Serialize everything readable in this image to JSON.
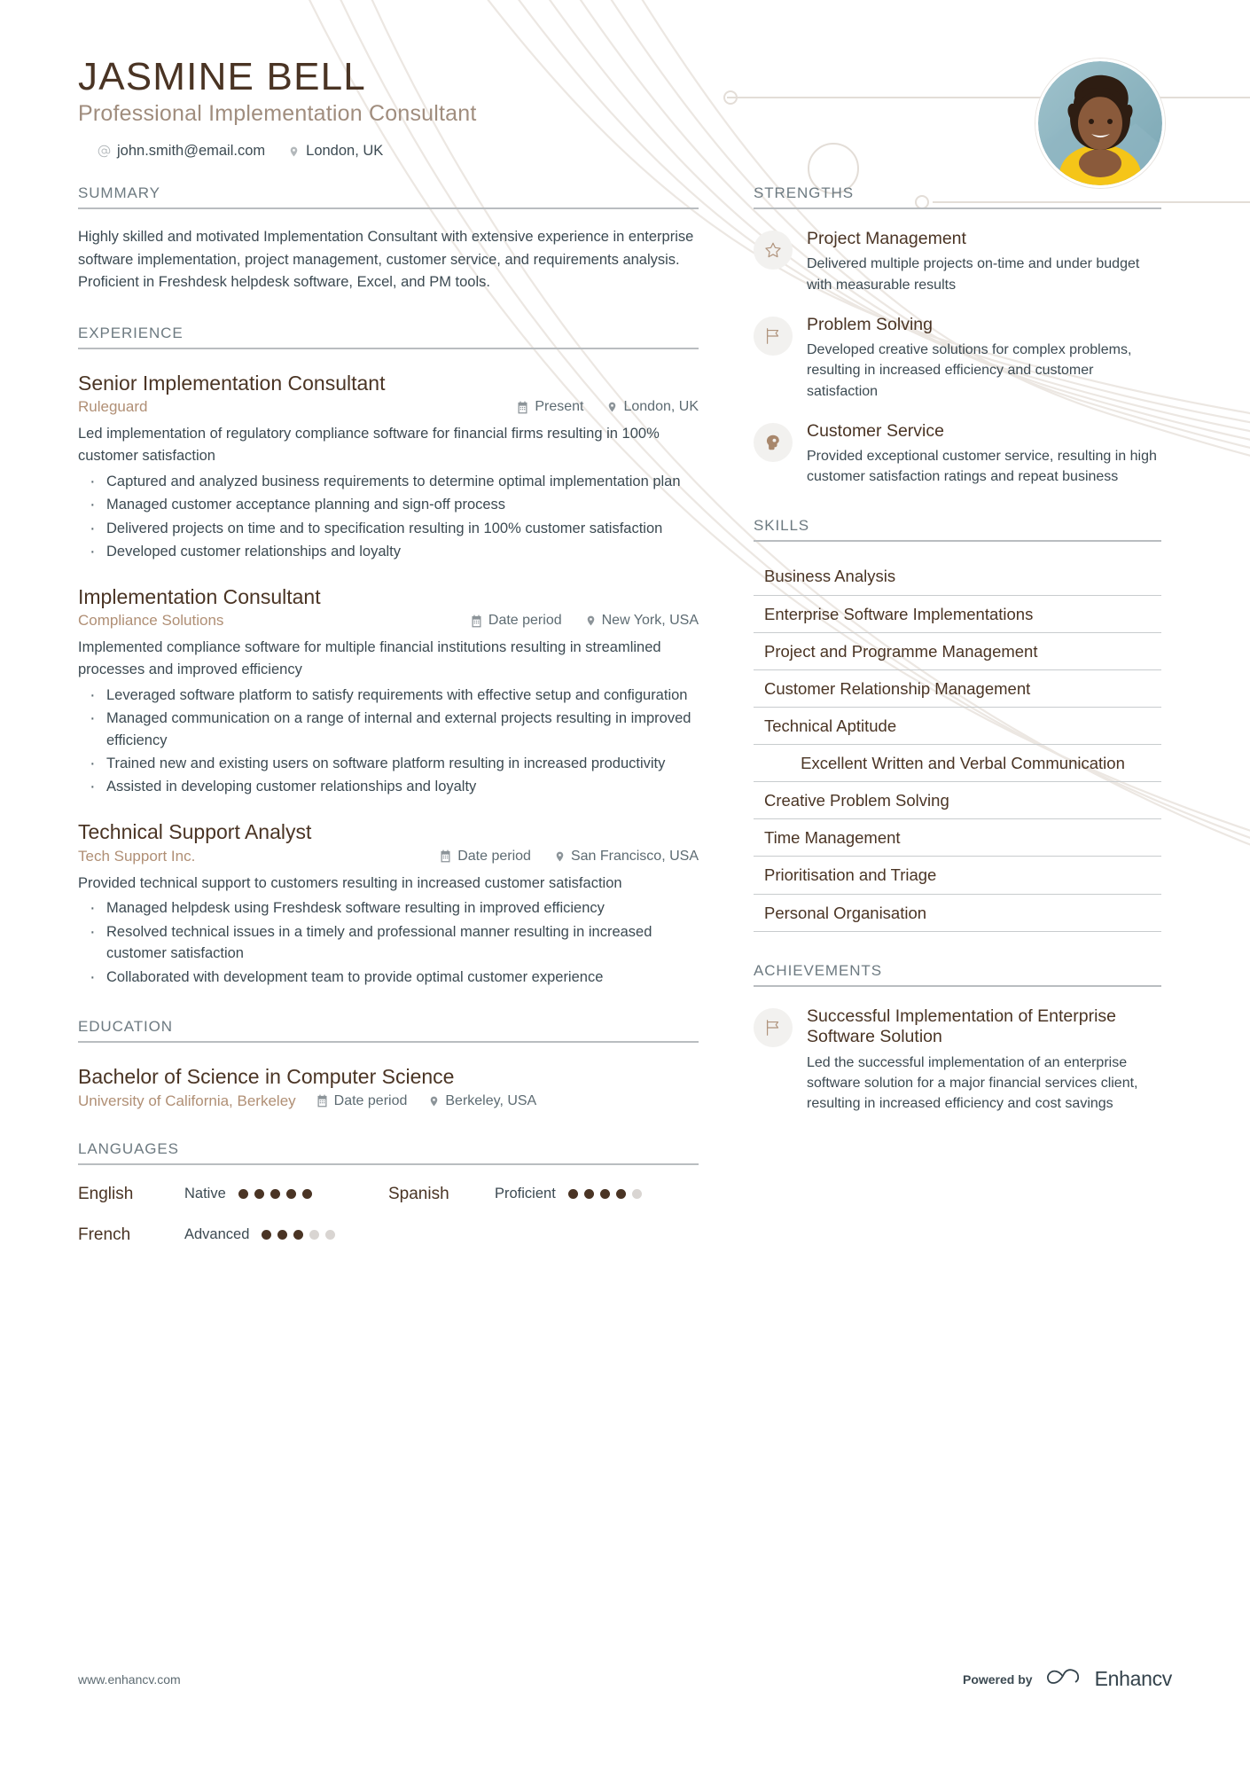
{
  "header": {
    "name": "JASMINE BELL",
    "job_title": "Professional Implementation Consultant",
    "email": "john.smith@email.com",
    "location": "London, UK",
    "email_icon": "at-sign-icon",
    "location_icon": "map-pin-icon",
    "avatar_alt": "profile-photo"
  },
  "colors": {
    "heading_brown": "#4a3424",
    "accent_tan": "#b08f75",
    "body_slate": "#3c4a52",
    "rule_gray": "#b9bdc0",
    "icon_bg": "#f2f1ef"
  },
  "summary": {
    "title": "SUMMARY",
    "text": "Highly skilled and motivated Implementation Consultant with extensive experience in enterprise software implementation, project management, customer service, and requirements analysis. Proficient in Freshdesk helpdesk software, Excel, and PM tools."
  },
  "experience": {
    "title": "EXPERIENCE",
    "jobs": [
      {
        "role": "Senior Implementation Consultant",
        "company": "Ruleguard",
        "date": "Present",
        "location": "London, UK",
        "description": "Led implementation of regulatory compliance software for financial firms resulting in 100% customer satisfaction",
        "bullets": [
          "Captured and analyzed business requirements to determine optimal implementation plan",
          "Managed customer acceptance planning and sign-off process",
          "Delivered projects on time and to specification resulting in 100% customer satisfaction",
          "Developed customer relationships and loyalty"
        ]
      },
      {
        "role": "Implementation Consultant",
        "company": "Compliance Solutions",
        "date": "Date period",
        "location": "New York, USA",
        "description": "Implemented compliance software for multiple financial institutions resulting in streamlined processes and improved efficiency",
        "bullets": [
          "Leveraged software platform to satisfy requirements with effective setup and configuration",
          "Managed communication on a range of internal and external projects resulting in improved efficiency",
          "Trained new and existing users on software platform resulting in increased productivity",
          "Assisted in developing customer relationships and loyalty"
        ]
      },
      {
        "role": "Technical Support Analyst",
        "company": "Tech Support Inc.",
        "date": "Date period",
        "location": "San Francisco, USA",
        "description": "Provided technical support to customers resulting in increased customer satisfaction",
        "bullets": [
          "Managed helpdesk using Freshdesk software resulting in improved efficiency",
          "Resolved technical issues in a timely and professional manner resulting in increased customer satisfaction",
          "Collaborated with development team to provide optimal customer experience"
        ]
      }
    ]
  },
  "education": {
    "title": "EDUCATION",
    "entries": [
      {
        "degree": "Bachelor of Science in Computer Science",
        "school": "University of California, Berkeley",
        "date": "Date period",
        "location": "Berkeley, USA"
      }
    ]
  },
  "languages": {
    "title": "LANGUAGES",
    "items": [
      {
        "name": "English",
        "level": "Native",
        "rating": 5,
        "max": 5
      },
      {
        "name": "Spanish",
        "level": "Proficient",
        "rating": 4,
        "max": 5
      },
      {
        "name": "French",
        "level": "Advanced",
        "rating": 3,
        "max": 5
      }
    ]
  },
  "strengths": {
    "title": "STRENGTHS",
    "items": [
      {
        "icon": "star-icon",
        "title": "Project Management",
        "description": "Delivered multiple projects on-time and under budget with measurable results"
      },
      {
        "icon": "flag-icon",
        "title": "Problem Solving",
        "description": "Developed creative solutions for complex problems, resulting in increased efficiency and customer satisfaction"
      },
      {
        "icon": "head-profile-icon",
        "title": "Customer Service",
        "description": "Provided exceptional customer service, resulting in high customer satisfaction ratings and repeat business"
      }
    ]
  },
  "skills": {
    "title": "SKILLS",
    "items": [
      "Business Analysis",
      "Enterprise Software Implementations",
      "Project and Programme Management",
      "Customer Relationship Management",
      "Technical Aptitude",
      "Excellent Written and Verbal Communication",
      "Creative Problem Solving",
      "Time Management",
      "Prioritisation and Triage",
      "Personal Organisation"
    ]
  },
  "achievements": {
    "title": "ACHIEVEMENTS",
    "items": [
      {
        "icon": "flag-icon",
        "title": "Successful Implementation of Enterprise Software Solution",
        "description": "Led the successful implementation of an enterprise software solution for a major financial services client, resulting in increased efficiency and cost savings"
      }
    ]
  },
  "footer": {
    "url": "www.enhancv.com",
    "powered_by": "Powered by",
    "brand": "Enhancv",
    "brand_icon": "infinity-logo-icon"
  }
}
